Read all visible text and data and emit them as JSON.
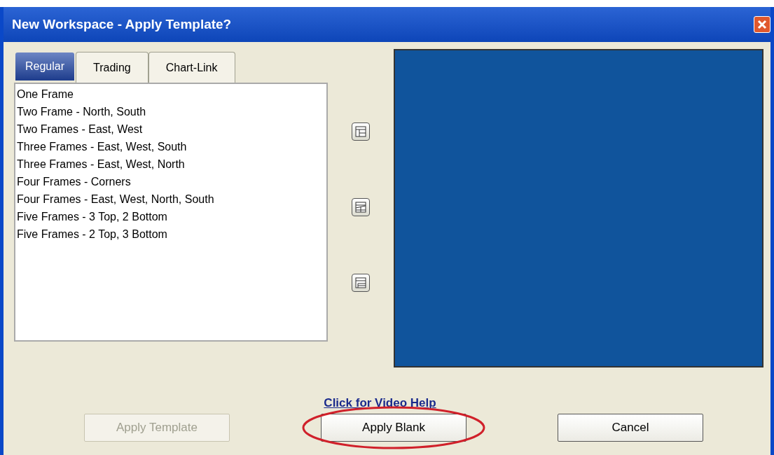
{
  "window": {
    "title": "New Workspace - Apply Template?"
  },
  "tabs": [
    {
      "label": "Regular",
      "selected": true
    },
    {
      "label": "Trading",
      "selected": false
    },
    {
      "label": "Chart-Link",
      "selected": false
    }
  ],
  "templates": [
    {
      "label": "One Frame",
      "selected": false
    },
    {
      "label": "Two Frame - North, South",
      "selected": false
    },
    {
      "label": "Two Frames - East, West",
      "selected": false
    },
    {
      "label": "Three Frames - East, West, South",
      "selected": false
    },
    {
      "label": "Three Frames - East, West, North",
      "selected": false
    },
    {
      "label": "Four Frames - Corners",
      "selected": false
    },
    {
      "label": "Four Frames - East, West, North, South",
      "selected": false
    },
    {
      "label": "Five Frames - 3 Top, 2 Bottom",
      "selected": false
    },
    {
      "label": "Five Frames - 2 Top, 3 Bottom",
      "selected": false
    }
  ],
  "help_link": "Click for Video Help",
  "buttons": [
    {
      "label": "Apply Template",
      "disabled": true,
      "highlighted": false
    },
    {
      "label": "Apply Blank",
      "disabled": false,
      "highlighted": true
    },
    {
      "label": "Cancel",
      "disabled": false,
      "highlighted": false
    }
  ]
}
